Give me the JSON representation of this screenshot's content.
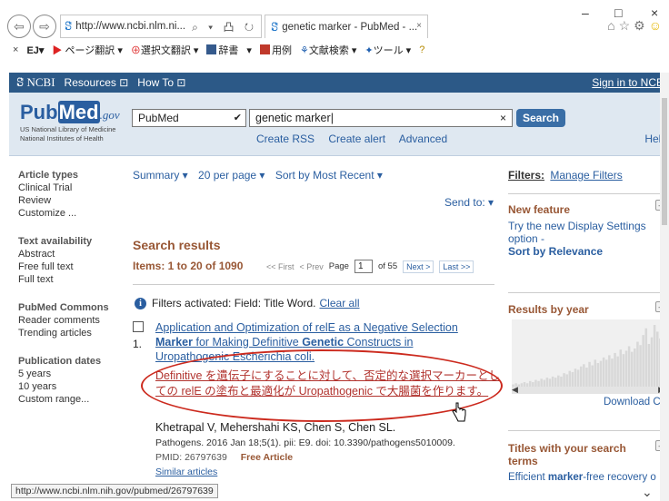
{
  "browser": {
    "address": "http://www.ncbi.nlm.ni...",
    "address_controls": "⌕ ▾ 凸 ↻",
    "tab_title": "genetic marker - PubMed - ...",
    "tab_close": "×",
    "win_min": "–",
    "win_max": "□",
    "win_close": "×",
    "toolbar": {
      "close": "×",
      "ej": "EJ▾",
      "page_translate": "ページ翻訳 ▾",
      "select_translate": "選択文翻訳 ▾",
      "dictionary": "辞書",
      "dict_arrow": "▾",
      "examples": "用例",
      "doc_search": "文献検索 ▾",
      "tools": "ツール ▾"
    },
    "status_url": "http://www.ncbi.nlm.nih.gov/pubmed/26797639"
  },
  "ncbi": {
    "logo": "NCBI",
    "resources": "Resources ⊡",
    "howto": "How To ⊡",
    "signin": "Sign in to NCB"
  },
  "search": {
    "logo_pub": "Pub",
    "logo_med": "Med",
    "logo_gov": ".gov",
    "nlm_line1": "US National Library of Medicine",
    "nlm_line2": "National Institutes of Health",
    "database": "PubMed",
    "term": "genetic marker",
    "clear": "×",
    "button": "Search",
    "link_rss": "Create RSS",
    "link_alert": "Create alert",
    "link_advanced": "Advanced",
    "help": "Help"
  },
  "sidebar": {
    "article_types": {
      "heading": "Article types",
      "items": [
        "Clinical Trial",
        "Review",
        "Customize ..."
      ]
    },
    "text_availability": {
      "heading": "Text availability",
      "items": [
        "Abstract",
        "Free full text",
        "Full text"
      ]
    },
    "pubmed_commons": {
      "heading": "PubMed Commons",
      "items": [
        "Reader comments",
        "Trending articles"
      ]
    },
    "publication_dates": {
      "heading": "Publication dates",
      "items": [
        "5 years",
        "10 years",
        "Custom range..."
      ]
    }
  },
  "results": {
    "format": "Summary ▾",
    "per_page": "20 per page ▾",
    "sort": "Sort by Most Recent ▾",
    "send_to": "Send to: ▾",
    "title": "Search results",
    "items": "Items: 1 to 20 of 1090",
    "first": "<< First",
    "prev": "< Prev",
    "page_label": "Page",
    "page": "1",
    "of_pages": "of 55",
    "next": "Next >",
    "last": "Last >>",
    "filters_text": "Filters activated: Field: Title Word.",
    "clear_all": "Clear all",
    "item": {
      "number": "1.",
      "title_l1": "Application and Optimization of relE as a Negative Selection",
      "title_l2_a": "Marker",
      "title_l2_b": " for Making Definitive ",
      "title_l2_c": "Genetic",
      "title_l2_d": " Constructs in",
      "title_l3": "Uropathogenic Escherichia coli.",
      "translation": "Definitive を遺伝子にすることに対して、否定的な選択マーカーとしての relE の塗布と最適化が Uropathogenic で大腸菌を作ります。",
      "authors": "Khetrapal V, Mehershahi KS, Chen S, Chen SL.",
      "citation": "Pathogens. 2016 Jan 18;5(1). pii: E9. doi: 10.3390/pathogens5010009.",
      "pmid": "PMID: 26797639",
      "free": "Free Article",
      "similar": "Similar articles"
    }
  },
  "right": {
    "filters_label": "Filters:",
    "manage_filters": "Manage Filters",
    "new_feature": "New feature",
    "nf_line1": "Try the new Display Settings option -",
    "nf_line2": "Sort by Relevance",
    "results_by_year": "Results by year",
    "download_csv": "Download CS",
    "titles_heading": "Titles with your search terms",
    "titles_item_a": "Efficient ",
    "titles_item_b": "marker",
    "titles_item_c": "-free recovery o",
    "collapse": "–"
  },
  "chart_data": {
    "type": "bar",
    "title": "Results by year",
    "values": [
      2,
      3,
      2,
      3,
      4,
      3,
      5,
      4,
      6,
      5,
      7,
      6,
      8,
      7,
      9,
      8,
      10,
      9,
      12,
      11,
      14,
      13,
      16,
      15,
      18,
      20,
      17,
      22,
      19,
      24,
      21,
      23,
      26,
      24,
      28,
      25,
      30,
      27,
      33,
      29,
      32,
      36,
      31,
      34,
      40,
      37,
      46,
      52,
      38,
      44,
      55,
      49,
      43,
      30
    ],
    "color": "#d8d8d8",
    "background": "#f0f0f0"
  }
}
